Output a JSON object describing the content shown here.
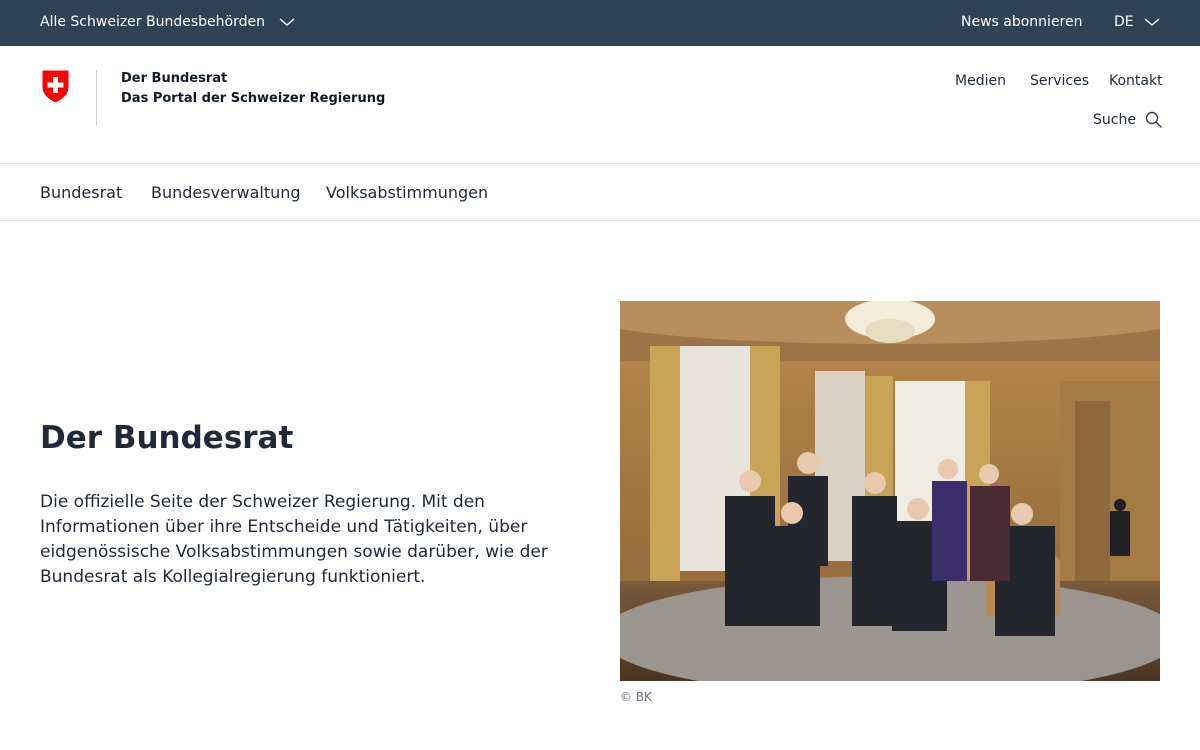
{
  "topbar": {
    "all_authorities": "Alle Schweizer Bundesbehörden",
    "news_subscribe": "News abonnieren",
    "language": "DE"
  },
  "brand": {
    "title": "Der Bundesrat",
    "subtitle": "Das Portal der Schweizer Regierung"
  },
  "utility_nav": {
    "items": [
      "Medien",
      "Services",
      "Kontakt"
    ],
    "search_label": "Suche"
  },
  "main_nav": {
    "items": [
      "Bundesrat",
      "Bundesverwaltung",
      "Volksabstimmungen"
    ]
  },
  "hero": {
    "title": "Der Bundesrat",
    "text": "Die offizielle Seite der Schweizer Regierung. Mit den Informationen über ihre Entscheide und Tätigkeiten, über eidgenössische Volksabstimmungen sowie darüber, wie der Bundesrat als Kollegialregierung funktioniert.",
    "image_credit": "© BK"
  },
  "colors": {
    "topbar_bg": "#2f4356",
    "swiss_red": "#ff0000"
  }
}
